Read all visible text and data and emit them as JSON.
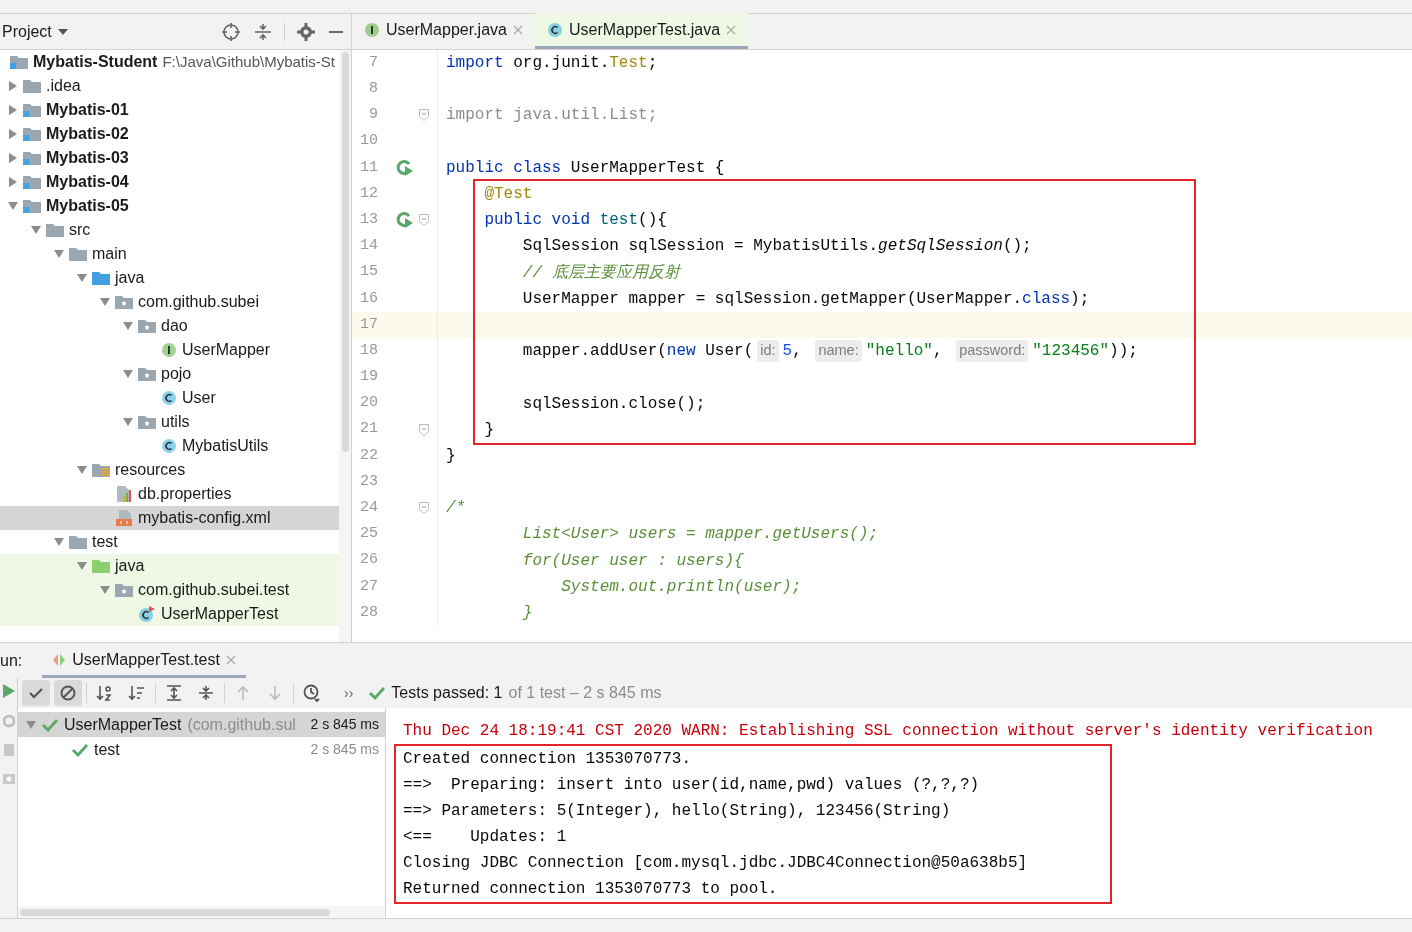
{
  "project_panel": {
    "title": "Project",
    "tree": [
      {
        "label": "Mybatis-Student",
        "path": "F:\\Java\\Github\\Mybatis-St",
        "kind": "module",
        "selected": false,
        "children": [
          {
            "label": ".idea",
            "kind": "folder",
            "expanded": false,
            "selected": false
          },
          {
            "label": "Mybatis-01",
            "kind": "module",
            "expanded": false,
            "selected": false
          },
          {
            "label": "Mybatis-02",
            "kind": "module",
            "expanded": false,
            "selected": false
          },
          {
            "label": "Mybatis-03",
            "kind": "module",
            "expanded": false,
            "selected": false
          },
          {
            "label": "Mybatis-04",
            "kind": "module",
            "expanded": false,
            "selected": false
          },
          {
            "label": "Mybatis-05",
            "kind": "module",
            "expanded": true,
            "selected": false,
            "children": [
              {
                "label": "src",
                "kind": "folder",
                "expanded": true,
                "selected": false,
                "children": [
                  {
                    "label": "main",
                    "kind": "folder",
                    "expanded": true,
                    "selected": false,
                    "children": [
                      {
                        "label": "java",
                        "kind": "source_folder",
                        "expanded": true,
                        "selected": false,
                        "children": [
                          {
                            "label": "com.github.subei",
                            "kind": "package",
                            "expanded": true,
                            "selected": false,
                            "children": [
                              {
                                "label": "dao",
                                "kind": "package",
                                "expanded": true,
                                "selected": false,
                                "children": [
                                  {
                                    "label": "UserMapper",
                                    "kind": "interface",
                                    "selected": false
                                  }
                                ]
                              },
                              {
                                "label": "pojo",
                                "kind": "package",
                                "expanded": true,
                                "selected": false,
                                "children": [
                                  {
                                    "label": "User",
                                    "kind": "class",
                                    "selected": false
                                  }
                                ]
                              },
                              {
                                "label": "utils",
                                "kind": "package",
                                "expanded": true,
                                "selected": false,
                                "children": [
                                  {
                                    "label": "MybatisUtils",
                                    "kind": "class",
                                    "selected": false
                                  }
                                ]
                              }
                            ]
                          }
                        ]
                      },
                      {
                        "label": "resources",
                        "kind": "resources_folder",
                        "expanded": true,
                        "selected": false,
                        "children": [
                          {
                            "label": "db.properties",
                            "kind": "properties",
                            "selected": false
                          },
                          {
                            "label": "mybatis-config.xml",
                            "kind": "xml",
                            "selected": true
                          }
                        ]
                      }
                    ]
                  },
                  {
                    "label": "test",
                    "kind": "folder",
                    "expanded": true,
                    "selected": false,
                    "children": [
                      {
                        "label": "java",
                        "kind": "test_source_folder",
                        "expanded": true,
                        "selected": false,
                        "test_source": true,
                        "children": [
                          {
                            "label": "com.github.subei.test",
                            "kind": "package",
                            "expanded": true,
                            "selected": false,
                            "test_source": true,
                            "children": [
                              {
                                "label": "UserMapperTest",
                                "kind": "test_class",
                                "selected": false,
                                "test_source": true
                              }
                            ]
                          }
                        ]
                      }
                    ]
                  }
                ]
              }
            ]
          }
        ]
      }
    ]
  },
  "editor_tabs": [
    {
      "label": "UserMapper.java",
      "kind": "interface",
      "selected": false
    },
    {
      "label": "UserMapperTest.java",
      "kind": "class",
      "selected": true
    }
  ],
  "code_lines": [
    {
      "number": "7",
      "run_marker": false,
      "fold_marker": false,
      "current": false,
      "boxed": false,
      "tokens": [
        {
          "kind": "kw",
          "text": "import "
        },
        {
          "kind": "plain",
          "text": "org.junit."
        },
        {
          "kind": "ann",
          "text": "Test"
        },
        {
          "kind": "plain",
          "text": ";"
        }
      ]
    },
    {
      "number": "8",
      "run_marker": false,
      "fold_marker": false,
      "current": false,
      "boxed": false
    },
    {
      "number": "9",
      "run_marker": false,
      "fold_marker": true,
      "current": false,
      "boxed": false,
      "tokens": [
        {
          "kind": "unused",
          "text": "import java.util.List;"
        }
      ]
    },
    {
      "number": "10",
      "run_marker": false,
      "fold_marker": false,
      "current": false,
      "boxed": false
    },
    {
      "number": "11",
      "run_marker": true,
      "fold_marker": false,
      "current": false,
      "boxed": false,
      "tokens": [
        {
          "kind": "kw",
          "text": "public class "
        },
        {
          "kind": "plain",
          "text": "UserMapperTest {"
        }
      ]
    },
    {
      "number": "12",
      "run_marker": false,
      "fold_marker": false,
      "current": false,
      "boxed": true,
      "tokens": [
        {
          "kind": "ann",
          "text": "    @Test"
        }
      ]
    },
    {
      "number": "13",
      "run_marker": true,
      "fold_marker": true,
      "current": false,
      "boxed": true,
      "tokens": [
        {
          "kind": "kw",
          "text": "    public void "
        },
        {
          "kind": "method",
          "text": "test"
        },
        {
          "kind": "plain",
          "text": "(){"
        }
      ]
    },
    {
      "number": "14",
      "run_marker": false,
      "fold_marker": false,
      "current": false,
      "boxed": true,
      "tokens": [
        {
          "kind": "plain",
          "text": "        SqlSession sqlSession = MybatisUtils."
        },
        {
          "kind": "static",
          "text": "getSqlSession"
        },
        {
          "kind": "plain",
          "text": "();"
        }
      ]
    },
    {
      "number": "15",
      "run_marker": false,
      "fold_marker": false,
      "current": false,
      "boxed": true,
      "tokens": [
        {
          "kind": "comment",
          "text": "        // 底层主要应用反射"
        }
      ]
    },
    {
      "number": "16",
      "run_marker": false,
      "fold_marker": false,
      "current": false,
      "boxed": true,
      "tokens": [
        {
          "kind": "plain",
          "text": "        UserMapper mapper = sqlSession.getMapper(UserMapper."
        },
        {
          "kind": "kw",
          "text": "class"
        },
        {
          "kind": "plain",
          "text": ");"
        }
      ]
    },
    {
      "number": "17",
      "run_marker": false,
      "fold_marker": false,
      "current": true,
      "boxed": true
    },
    {
      "number": "18",
      "run_marker": false,
      "fold_marker": false,
      "current": false,
      "boxed": true,
      "tokens": [
        {
          "kind": "plain",
          "text": "        mapper.addUser("
        },
        {
          "kind": "kw",
          "text": "new"
        },
        {
          "kind": "plain",
          "text": " User("
        },
        {
          "kind": "hint",
          "text": "id:"
        },
        {
          "kind": "number",
          "text": "5"
        },
        {
          "kind": "plain",
          "text": ", "
        },
        {
          "kind": "hint",
          "text": "name:"
        },
        {
          "kind": "string",
          "text": "\"hello\""
        },
        {
          "kind": "plain",
          "text": ", "
        },
        {
          "kind": "hint",
          "text": "password:"
        },
        {
          "kind": "string",
          "text": "\"123456\""
        },
        {
          "kind": "plain",
          "text": "));"
        }
      ]
    },
    {
      "number": "19",
      "run_marker": false,
      "fold_marker": false,
      "current": false,
      "boxed": true
    },
    {
      "number": "20",
      "run_marker": false,
      "fold_marker": false,
      "current": false,
      "boxed": true,
      "tokens": [
        {
          "kind": "plain",
          "text": "        sqlSession.close();"
        }
      ]
    },
    {
      "number": "21",
      "run_marker": false,
      "fold_marker": true,
      "current": false,
      "boxed": true,
      "tokens": [
        {
          "kind": "plain",
          "text": "    }"
        }
      ]
    },
    {
      "number": "22",
      "run_marker": false,
      "fold_marker": false,
      "current": false,
      "boxed": false,
      "tokens": [
        {
          "kind": "plain",
          "text": "}"
        }
      ]
    },
    {
      "number": "23",
      "run_marker": false,
      "fold_marker": false,
      "current": false,
      "boxed": false
    },
    {
      "number": "24",
      "run_marker": false,
      "fold_marker": true,
      "current": false,
      "boxed": false,
      "tokens": [
        {
          "kind": "comment",
          "text": "/*"
        }
      ]
    },
    {
      "number": "25",
      "run_marker": false,
      "fold_marker": false,
      "current": false,
      "boxed": false,
      "tokens": [
        {
          "kind": "comment",
          "text": "        List<User> users = mapper.getUsers();"
        }
      ]
    },
    {
      "number": "26",
      "run_marker": false,
      "fold_marker": false,
      "current": false,
      "boxed": false,
      "tokens": [
        {
          "kind": "comment",
          "text": "        for(User user : users){"
        }
      ]
    },
    {
      "number": "27",
      "run_marker": false,
      "fold_marker": false,
      "current": false,
      "boxed": false,
      "tokens": [
        {
          "kind": "comment",
          "text": "            System.out.println(user);"
        }
      ]
    },
    {
      "number": "28",
      "run_marker": false,
      "fold_marker": false,
      "current": false,
      "boxed": false,
      "tokens": [
        {
          "kind": "comment",
          "text": "        }"
        }
      ]
    }
  ],
  "run_panel": {
    "label": "un:",
    "tab": {
      "label": "UserMapperTest.test",
      "selected": true
    },
    "toolbar": [
      {
        "kind": "check",
        "on": true
      },
      {
        "kind": "ban",
        "on": true
      },
      {
        "kind": "sort_alpha",
        "on": false
      },
      {
        "kind": "sort_duration",
        "on": false
      },
      {
        "kind": "expand",
        "on": false
      },
      {
        "kind": "collapse",
        "on": false
      },
      {
        "kind": "up",
        "on": false
      },
      {
        "kind": "down",
        "on": false
      },
      {
        "kind": "clock",
        "on": false
      }
    ],
    "more": "››",
    "status": {
      "passed": "Tests passed: 1",
      "detail": "of 1 test – 2 s 845 ms"
    },
    "tests": [
      {
        "name": "UserMapperTest",
        "package": "(com.github.sul",
        "time": "2 s 845 ms",
        "passed": true,
        "selected": true,
        "expanded": true,
        "children": [
          {
            "name": "test",
            "time": "2 s 845 ms",
            "passed": true,
            "selected": false
          }
        ]
      }
    ],
    "console": [
      {
        "kind": "warn",
        "boxed": false,
        "text": "Thu Dec 24 18:19:41 CST 2020 WARN: Establishing SSL connection without server's identity verification"
      },
      {
        "kind": "out",
        "boxed": true,
        "text": "Created connection 1353070773."
      },
      {
        "kind": "out",
        "boxed": true,
        "text": "==>  Preparing: insert into user(id,name,pwd) values (?,?,?)"
      },
      {
        "kind": "out",
        "boxed": true,
        "text": "==> Parameters: 5(Integer), hello(String), 123456(String)"
      },
      {
        "kind": "out",
        "boxed": true,
        "text": "<==    Updates: 1"
      },
      {
        "kind": "out",
        "boxed": true,
        "text": "Closing JDBC Connection [com.mysql.jdbc.JDBC4Connection@50a638b5]"
      },
      {
        "kind": "out",
        "boxed": true,
        "text": "Returned connection 1353070773 to pool."
      }
    ]
  }
}
